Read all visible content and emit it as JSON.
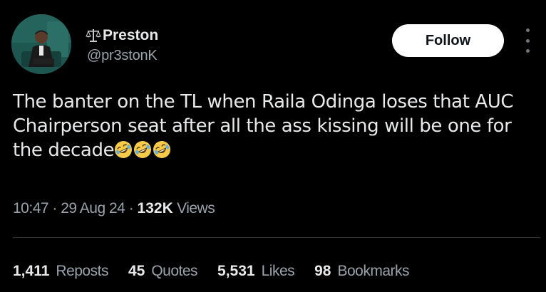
{
  "author": {
    "display_name": "Preston",
    "handle": "@pr3stonK",
    "name_prefix_icon": "balance-scale-icon"
  },
  "follow_button": {
    "label": "Follow"
  },
  "tweet": {
    "text": "The banter on the TL when Raila Odinga loses that AUC Chairperson seat after all the ass kissing will be one for the decade",
    "emojis": [
      "rolling-on-floor-laughing",
      "rolling-on-floor-laughing",
      "rolling-on-floor-laughing"
    ]
  },
  "meta": {
    "time": "10:47",
    "separator": "·",
    "date": "29 Aug 24",
    "views_count": "132K",
    "views_label": "Views"
  },
  "stats": {
    "reposts": {
      "count": "1,411",
      "label": "Reposts"
    },
    "quotes": {
      "count": "45",
      "label": "Quotes"
    },
    "likes": {
      "count": "5,531",
      "label": "Likes"
    },
    "bookmarks": {
      "count": "98",
      "label": "Bookmarks"
    }
  },
  "colors": {
    "background": "#000000",
    "primary_text": "#e7e9ea",
    "secondary_text": "#9aa3ab",
    "divider": "#2f3336",
    "follow_bg": "#ffffff"
  }
}
